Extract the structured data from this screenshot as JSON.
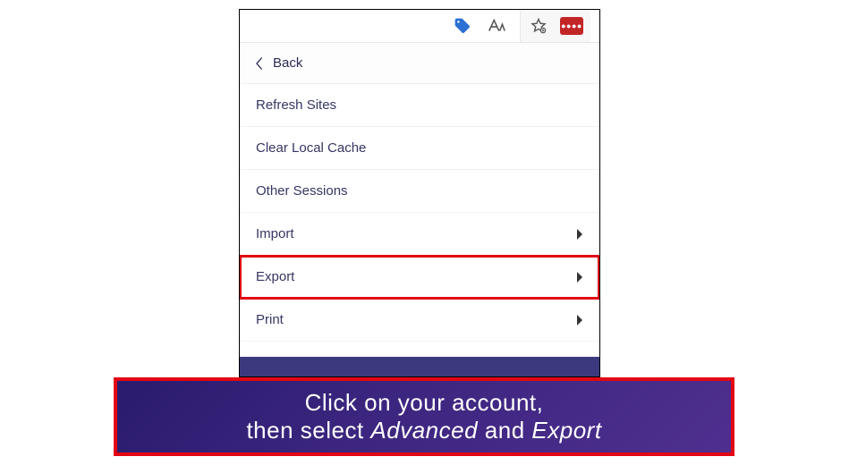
{
  "toolbar": {
    "icons": {
      "tag": "tag-icon",
      "text": "text-size-icon",
      "favorite": "favorite-star-icon",
      "extension": "lastpass-extension-icon"
    }
  },
  "back": {
    "label": "Back"
  },
  "menu": {
    "refresh": "Refresh Sites",
    "clear_cache": "Clear Local Cache",
    "other_sessions": "Other Sessions",
    "import": "Import",
    "export": "Export",
    "print": "Print"
  },
  "caption": {
    "line1": "Click on your account,",
    "line2_pre": "then select ",
    "line2_adv": "Advanced",
    "line2_mid": " and ",
    "line2_exp": "Export"
  }
}
